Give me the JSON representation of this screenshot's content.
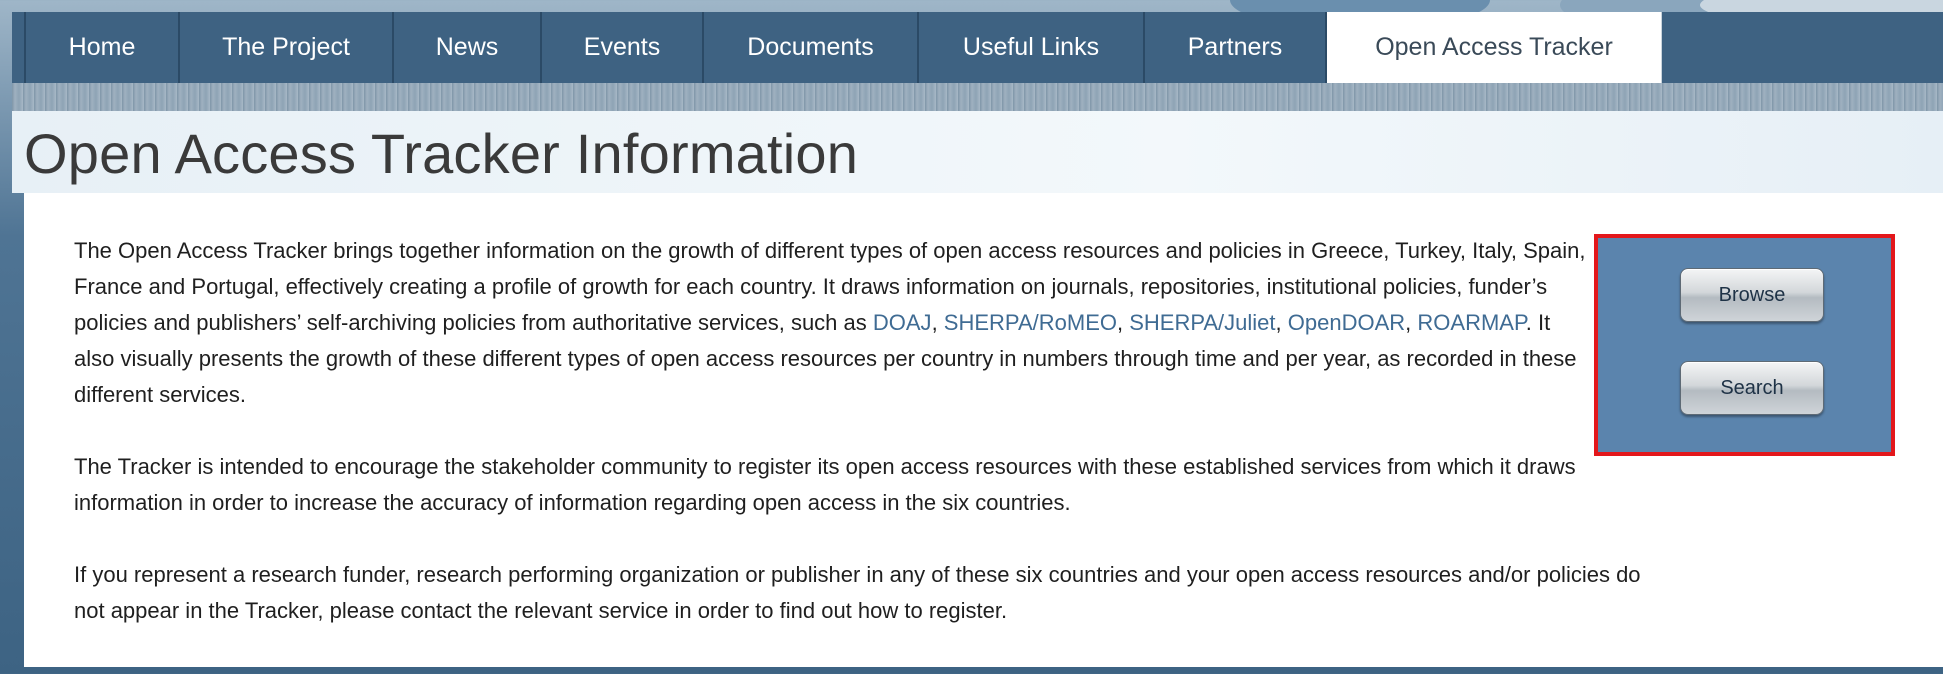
{
  "nav": {
    "items": [
      {
        "label": "Home"
      },
      {
        "label": "The Project"
      },
      {
        "label": "News"
      },
      {
        "label": "Events"
      },
      {
        "label": "Documents"
      },
      {
        "label": "Useful Links"
      },
      {
        "label": "Partners"
      },
      {
        "label": "Open Access Tracker"
      }
    ],
    "active": "Open Access Tracker"
  },
  "page_title": "Open Access Tracker Information",
  "content": {
    "p1_part1": "The Open Access Tracker brings together information on the growth of different types of open access resources and policies in Greece, Turkey, Italy, Spain, France and Portugal, effectively creating a profile of growth for each country. It draws information on journals, repositories, institutional policies, funder’s policies and publishers’ self-archiving policies from authoritative services, such as ",
    "links": [
      "DOAJ",
      "SHERPA/RoMEO",
      "SHERPA/Juliet",
      "OpenDOAR",
      "ROARMAP"
    ],
    "sep_comma": ", ",
    "p1_part2": ". It also visually presents the growth of these different types of open access resources per country in numbers through time and per year, as recorded in these different services.",
    "p2": "The Tracker is intended to encourage the stakeholder community to register its open access resources with these established services from which it draws information in order to increase the accuracy of information regarding open access in the six countries.",
    "p3": "If you represent a research funder, research performing organization or publisher in any of these six countries and your open access resources and/or policies do not appear in the Tracker, please contact the relevant service in order to find out how to register."
  },
  "actions": {
    "browse_label": "Browse",
    "search_label": "Search"
  },
  "colors": {
    "nav_bg": "#3e6282",
    "link": "#3f6b93",
    "action_box_bg": "#5b84ad",
    "highlight_border": "#e3171b"
  }
}
